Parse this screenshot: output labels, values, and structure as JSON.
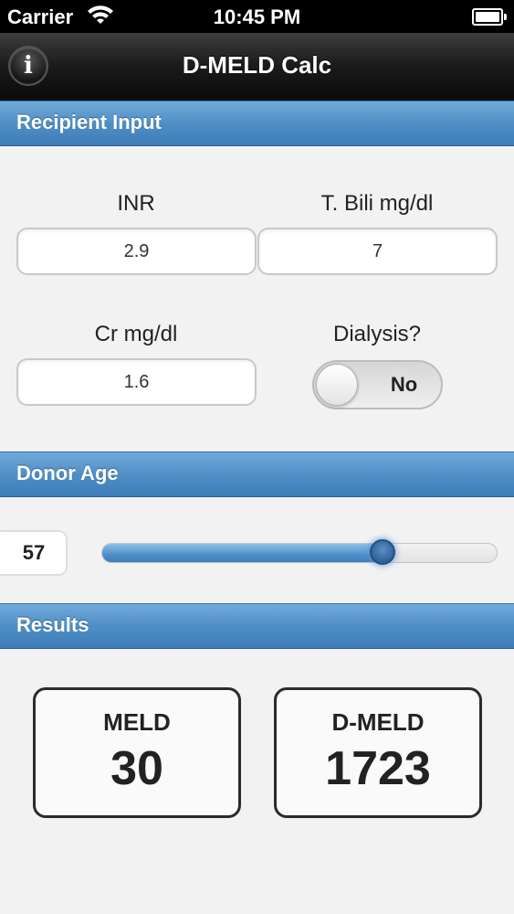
{
  "status_bar": {
    "carrier": "Carrier",
    "time": "10:45 PM",
    "wifi_icon": "wifi-icon",
    "battery_icon": "battery-icon"
  },
  "nav": {
    "title": "D-MELD Calc",
    "info_icon": "info-icon",
    "info_glyph": "i"
  },
  "recipient": {
    "header": "Recipient Input",
    "inr": {
      "label": "INR",
      "value": "2.9"
    },
    "bili": {
      "label": "T. Bili mg/dl",
      "value": "7"
    },
    "cr": {
      "label": "Cr mg/dl",
      "value": "1.6"
    },
    "dialysis": {
      "label": "Dialysis?",
      "value": "No"
    }
  },
  "donor": {
    "header": "Donor Age",
    "age": "57",
    "slider_fraction": 0.71
  },
  "results": {
    "header": "Results",
    "meld": {
      "label": "MELD",
      "value": "30"
    },
    "dmeld": {
      "label": "D-MELD",
      "value": "1723"
    }
  },
  "colors": {
    "accent": "#4f8fc6",
    "title_bar": "#1a1a1a",
    "background": "#f2f2f2"
  }
}
